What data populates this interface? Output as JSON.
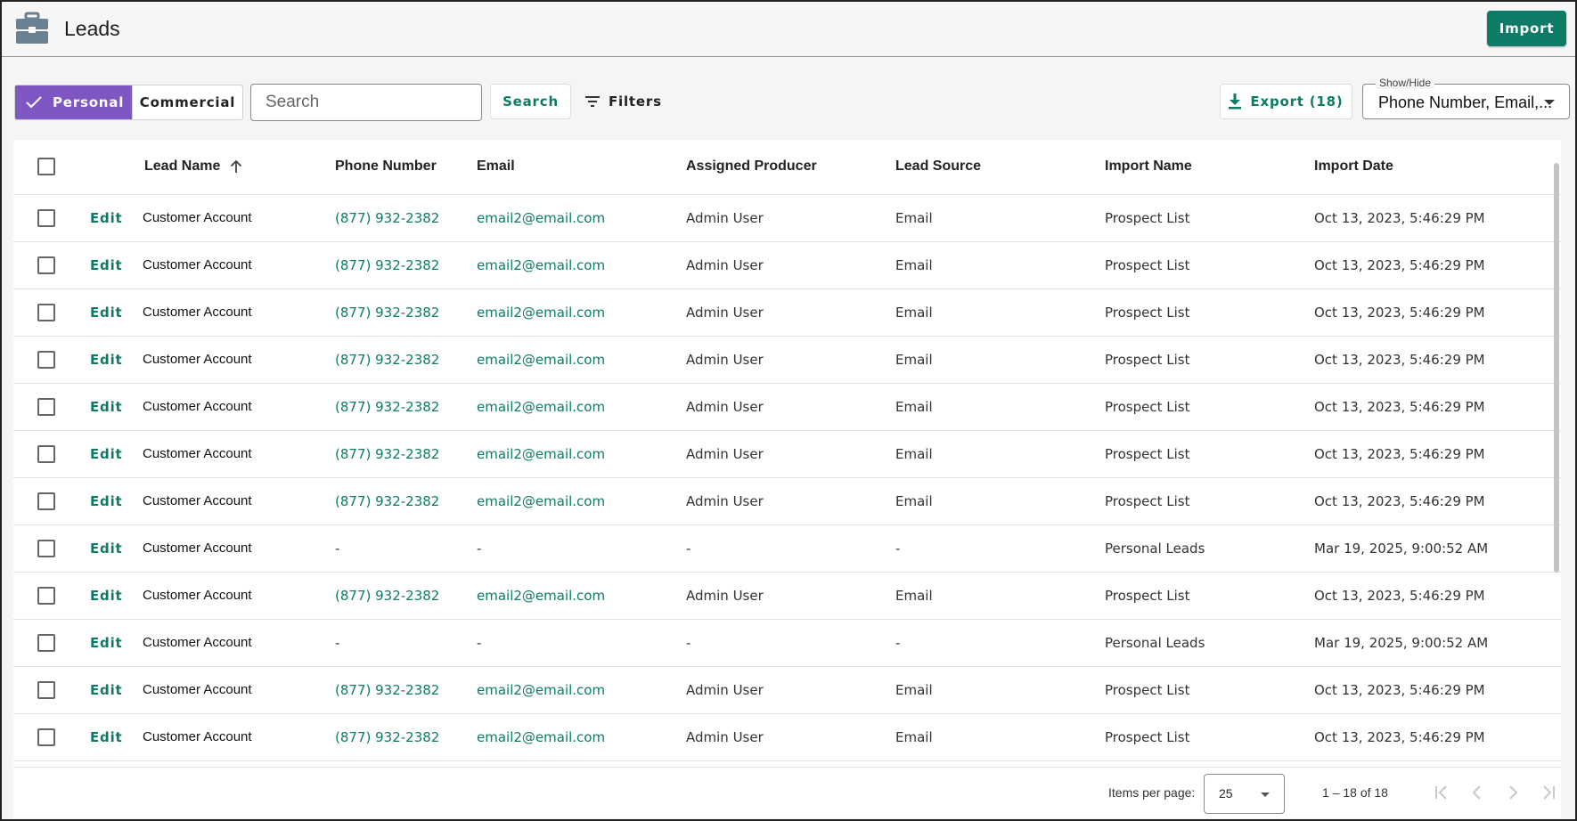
{
  "header": {
    "title": "Leads",
    "import_label": "Import"
  },
  "toolbar": {
    "personal_label": "Personal",
    "commercial_label": "Commercial",
    "search_placeholder": "Search",
    "search_label": "Search",
    "filters_label": "Filters",
    "export_label": "Export (18)",
    "showhide_label": "Show/Hide",
    "showhide_value": "Phone Number, Email,..."
  },
  "table": {
    "columns": [
      "Lead Name",
      "Phone Number",
      "Email",
      "Assigned Producer",
      "Lead Source",
      "Import Name",
      "Import Date"
    ],
    "edit_label": "Edit",
    "rows": [
      {
        "name": "Customer Account",
        "phone": "(877) 932-2382",
        "email": "email2@email.com",
        "producer": "Admin User",
        "source": "Email",
        "import_name": "Prospect List",
        "import_date": "Oct 13, 2023, 5:46:29 PM"
      },
      {
        "name": "Customer Account",
        "phone": "(877) 932-2382",
        "email": "email2@email.com",
        "producer": "Admin User",
        "source": "Email",
        "import_name": "Prospect List",
        "import_date": "Oct 13, 2023, 5:46:29 PM"
      },
      {
        "name": "Customer Account",
        "phone": "(877) 932-2382",
        "email": "email2@email.com",
        "producer": "Admin User",
        "source": "Email",
        "import_name": "Prospect List",
        "import_date": "Oct 13, 2023, 5:46:29 PM"
      },
      {
        "name": "Customer Account",
        "phone": "(877) 932-2382",
        "email": "email2@email.com",
        "producer": "Admin User",
        "source": "Email",
        "import_name": "Prospect List",
        "import_date": "Oct 13, 2023, 5:46:29 PM"
      },
      {
        "name": "Customer Account",
        "phone": "(877) 932-2382",
        "email": "email2@email.com",
        "producer": "Admin User",
        "source": "Email",
        "import_name": "Prospect List",
        "import_date": "Oct 13, 2023, 5:46:29 PM"
      },
      {
        "name": "Customer Account",
        "phone": "(877) 932-2382",
        "email": "email2@email.com",
        "producer": "Admin User",
        "source": "Email",
        "import_name": "Prospect List",
        "import_date": "Oct 13, 2023, 5:46:29 PM"
      },
      {
        "name": "Customer Account",
        "phone": "(877) 932-2382",
        "email": "email2@email.com",
        "producer": "Admin User",
        "source": "Email",
        "import_name": "Prospect List",
        "import_date": "Oct 13, 2023, 5:46:29 PM"
      },
      {
        "name": "Customer Account",
        "phone": "-",
        "email": "-",
        "producer": "-",
        "source": "-",
        "import_name": "Personal Leads",
        "import_date": "Mar 19, 2025, 9:00:52 AM"
      },
      {
        "name": "Customer Account",
        "phone": "(877) 932-2382",
        "email": "email2@email.com",
        "producer": "Admin User",
        "source": "Email",
        "import_name": "Prospect List",
        "import_date": "Oct 13, 2023, 5:46:29 PM"
      },
      {
        "name": "Customer Account",
        "phone": "-",
        "email": "-",
        "producer": "-",
        "source": "-",
        "import_name": "Personal Leads",
        "import_date": "Mar 19, 2025, 9:00:52 AM"
      },
      {
        "name": "Customer Account",
        "phone": "(877) 932-2382",
        "email": "email2@email.com",
        "producer": "Admin User",
        "source": "Email",
        "import_name": "Prospect List",
        "import_date": "Oct 13, 2023, 5:46:29 PM"
      },
      {
        "name": "Customer Account",
        "phone": "(877) 932-2382",
        "email": "email2@email.com",
        "producer": "Admin User",
        "source": "Email",
        "import_name": "Prospect List",
        "import_date": "Oct 13, 2023, 5:46:29 PM"
      }
    ]
  },
  "paginator": {
    "items_per_page_label": "Items per page:",
    "items_per_page_value": "25",
    "range_label": "1 – 18 of 18"
  },
  "colors": {
    "accent": "#0e7b66",
    "toggle_active": "#7f57c2"
  }
}
